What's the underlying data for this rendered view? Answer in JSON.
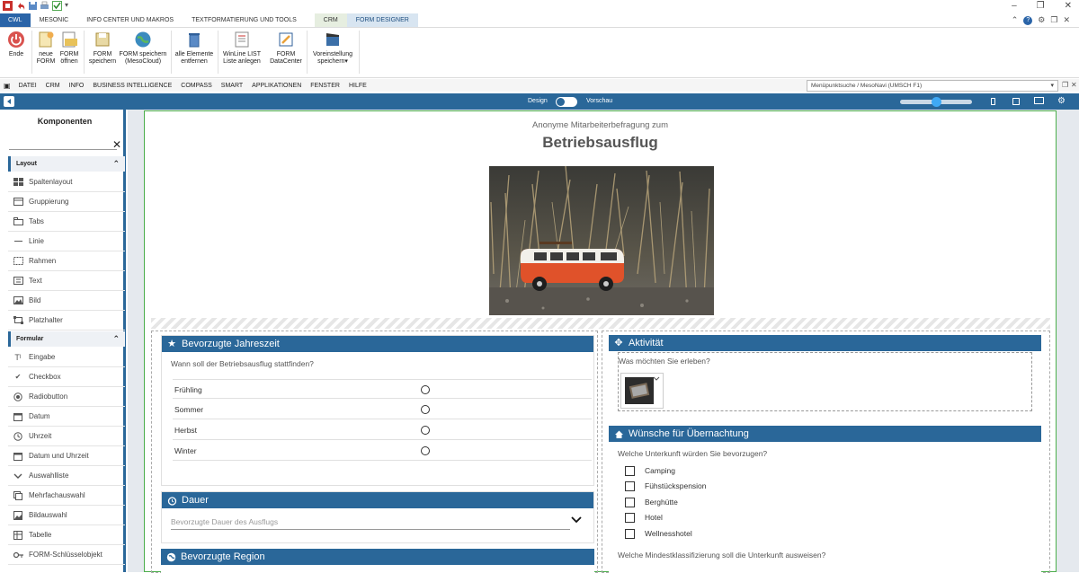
{
  "ribbon_tabs": [
    "CWL",
    "MESONIC",
    "INFO CENTER UND MAKROS",
    "TEXTFORMATIERUNG UND TOOLS",
    "CRM",
    "FORM DESIGNER"
  ],
  "ribbon_buttons": {
    "ende": "Ende",
    "neue_form": "neue FORM",
    "form_oeffnen": "FORM öffnen",
    "form_speichern": "FORM speichern",
    "form_speichern_cloud": "FORM speichern (MesoCloud)",
    "alle_entfernen": "alle Elemente entfernen",
    "winline_list": "WinLine LIST Liste anlegen",
    "form_datacenter": "FORM DataCenter",
    "voreinstellung": "Voreinstellung speichern"
  },
  "menu": [
    "DATEI",
    "CRM",
    "INFO",
    "BUSINESS INTELLIGENCE",
    "COMPASS",
    "SMART",
    "APPLIKATIONEN",
    "FENSTER",
    "HILFE"
  ],
  "nav_search": "Menüpunktsuche / MesoNavi (UMSCH F1)",
  "designer": {
    "design_label": "Design",
    "preview_label": "Vorschau"
  },
  "sidebar": {
    "title": "Komponenten",
    "search_value": "",
    "layout_section": "Layout",
    "layout_items": [
      "Spaltenlayout",
      "Gruppierung",
      "Tabs",
      "Linie",
      "Rahmen",
      "Text",
      "Bild",
      "Platzhalter"
    ],
    "formular_section": "Formular",
    "formular_items": [
      "Eingabe",
      "Checkbox",
      "Radiobutton",
      "Datum",
      "Uhrzeit",
      "Datum und Uhrzeit",
      "Auswahlliste",
      "Mehrfachauswahl",
      "Bildauswahl",
      "Tabelle",
      "FORM-Schlüsselobjekt"
    ]
  },
  "form": {
    "subtitle": "Anonyme Mitarbeiterbefragung zum",
    "title": "Betriebsausflug",
    "season": {
      "title": "Bevorzugte Jahreszeit",
      "question": "Wann soll der Betriebsausflug stattfinden?",
      "options": [
        "Frühling",
        "Sommer",
        "Herbst",
        "Winter"
      ]
    },
    "duration": {
      "title": "Dauer",
      "placeholder": "Bevorzugte Dauer des Ausflugs"
    },
    "region": {
      "title": "Bevorzugte Region"
    },
    "activity": {
      "title": "Aktivität",
      "question": "Was möchten Sie erleben?"
    },
    "overnight": {
      "title": "Wünsche für Übernachtung",
      "question": "Welche Unterkunft würden Sie bevorzugen?",
      "options": [
        "Camping",
        "Fühstückspension",
        "Berghütte",
        "Hotel",
        "Wellnesshotel"
      ],
      "question2": "Welche Mindestklassifizierung soll die Unterkunft ausweisen?"
    }
  },
  "colors": {
    "accent": "#2a6799",
    "tab_active": "#2a64a8",
    "canvas_border": "#4cae4c"
  }
}
